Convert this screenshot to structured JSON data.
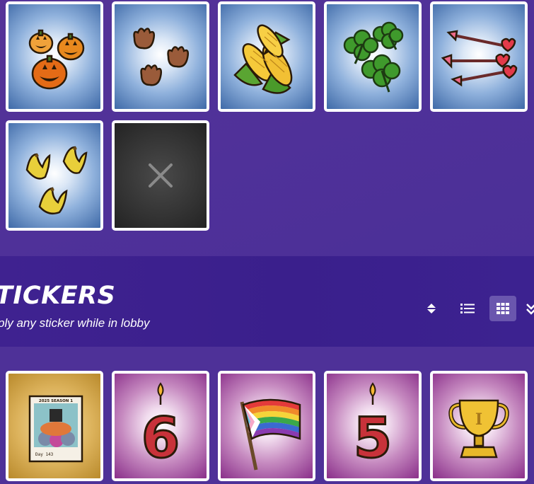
{
  "section": {
    "title": "TICKERS",
    "subtitle": "ply any sticker while in lobby"
  },
  "view_controls": [
    {
      "icon": "sort-icon",
      "label": "Sort"
    },
    {
      "icon": "list-view-icon",
      "label": "List view"
    },
    {
      "icon": "grid-view-icon",
      "label": "Grid view",
      "active": true
    },
    {
      "icon": "double-chevron-down-icon",
      "label": "Collapse"
    }
  ],
  "top_items": [
    {
      "icon": "jack-o-lanterns-icon",
      "rarity": "blue"
    },
    {
      "icon": "brown-paw-prints-icon",
      "rarity": "blue"
    },
    {
      "icon": "corn-cobs-icon",
      "rarity": "blue"
    },
    {
      "icon": "four-leaf-clovers-icon",
      "rarity": "blue"
    },
    {
      "icon": "heart-arrows-icon",
      "rarity": "blue"
    },
    {
      "icon": "banana-peels-icon",
      "rarity": "blue"
    },
    {
      "icon": "none-x-icon",
      "rarity": "empty"
    }
  ],
  "stickers": [
    {
      "icon": "season-photo-icon",
      "rarity": "gold",
      "photo_text": "2025 SEASON 1",
      "photo_caption": "Day 143"
    },
    {
      "icon": "candle-six-icon",
      "rarity": "purple",
      "digit": "6"
    },
    {
      "icon": "pride-flag-icon",
      "rarity": "purple"
    },
    {
      "icon": "candle-five-icon",
      "rarity": "purple",
      "digit": "5"
    },
    {
      "icon": "trophy-icon",
      "rarity": "purple",
      "trophy_mark": "I"
    }
  ],
  "colors": {
    "background": "#4f3196",
    "header_band": "#3c2190",
    "active_button": "#6a56ae",
    "card_border": "#ffffff"
  }
}
